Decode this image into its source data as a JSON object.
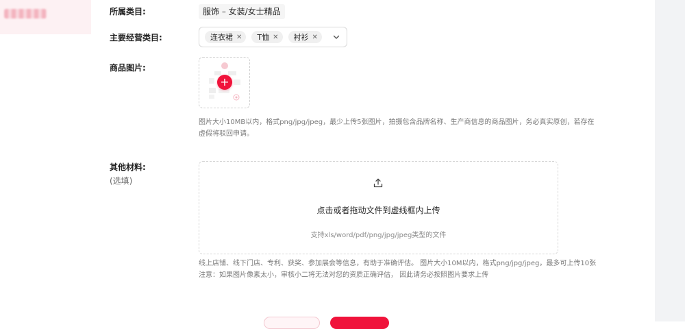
{
  "sidebar": {
    "active_item_blurred": true
  },
  "form": {
    "category_label": "所属类目:",
    "category_value": "服饰 – 女装/女士精品",
    "main_category_label": "主要经营类目:",
    "main_category_tags": [
      {
        "label": "连衣裙"
      },
      {
        "label": "T恤"
      },
      {
        "label": "衬衫"
      }
    ],
    "product_images_label": "商品图片:",
    "product_images_help_line1": "图片大小10MB以内，格式png/jpg/jpeg，最少上传5张图片，拍摄包含品牌名称、生产商信息的商品图片，务必真实原创，若存在",
    "product_images_help_line2": "虚假将驳回申请。",
    "other_materials_label": "其他材料:",
    "other_materials_optional": "(选填)",
    "dropzone_title": "点击或者拖动文件到虚线框内上传",
    "dropzone_hint": "支持xls/word/pdf/png/jpg/jpeg类型的文件",
    "other_help_line1": "线上店铺、线下门店、专利、获奖、参加展会等信息，有助于准确评估。 图片大小10M以内，格式png/jpg/jpeg，最多可上传10张",
    "other_help_line2": "注意：如果图片像素太小，审核小二将无法对您的资质正确评估， 因此请务必按照图片要求上传"
  },
  "colors": {
    "accent": "#f0133b",
    "sidebar_active_bg": "#fdf1f3",
    "right_panel_bg": "#f2f3f5"
  },
  "icons": {
    "tag_remove": "close-icon",
    "select_arrow": "chevron-down-icon",
    "add_image": "plus-icon",
    "upload": "upload-icon"
  }
}
